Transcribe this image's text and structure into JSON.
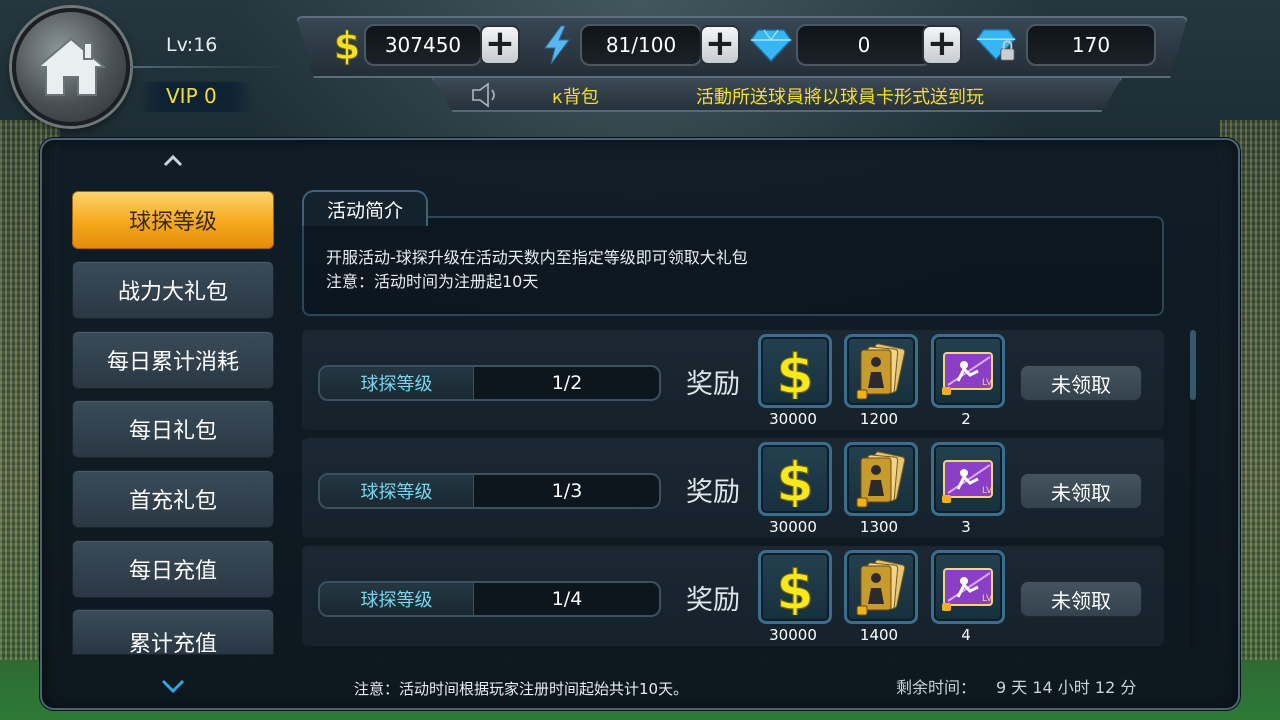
{
  "player": {
    "level": "Lv:16",
    "vip": "VIP 0"
  },
  "resources": {
    "gold": "307450",
    "energy": "81/100",
    "diamonds": "0",
    "locked_diamonds": "170",
    "plus_symbol": "+"
  },
  "ticker": {
    "text_a": "к背包",
    "text_b": "活動所送球員將以球員卡形式送到玩"
  },
  "sidebar": {
    "items": [
      {
        "label": "球探等级"
      },
      {
        "label": "战力大礼包"
      },
      {
        "label": "每日累计消耗"
      },
      {
        "label": "每日礼包"
      },
      {
        "label": "首充礼包"
      },
      {
        "label": "每日充值"
      },
      {
        "label": "累计充值"
      }
    ]
  },
  "intro": {
    "tab_label": "活动简介",
    "line1": "开服活动-球探升级在活动天数内至指定等级即可领取大礼包",
    "line2": "注意：活动时间为注册起10天"
  },
  "rewards": {
    "reward_label": "奖励",
    "rows": [
      {
        "name": "球探等级",
        "progress": "1/2",
        "gold": "30000",
        "cards": "1200",
        "ticket": "2",
        "status": "未领取"
      },
      {
        "name": "球探等级",
        "progress": "1/3",
        "gold": "30000",
        "cards": "1300",
        "ticket": "3",
        "status": "未领取"
      },
      {
        "name": "球探等级",
        "progress": "1/4",
        "gold": "30000",
        "cards": "1400",
        "ticket": "4",
        "status": "未领取"
      }
    ]
  },
  "footer": {
    "note": "注意：活动时间根据玩家注册时间起始共计10天。",
    "remaining_label": "剩余时间：",
    "remaining_value": "9 天 14 小时 12 分"
  },
  "icons": {
    "home": "home-icon",
    "gold": "dollar-icon",
    "energy": "lightning-icon",
    "diamond": "diamond-icon",
    "locked_diamond": "locked-diamond-icon",
    "speaker": "speaker-icon",
    "chevron_up": "chevron-up-icon",
    "chevron_down": "chevron-down-icon"
  },
  "colors": {
    "accent_gold": "#f5df2a",
    "active_tab": "#f5a81c",
    "level_text": "#76d6ee"
  }
}
